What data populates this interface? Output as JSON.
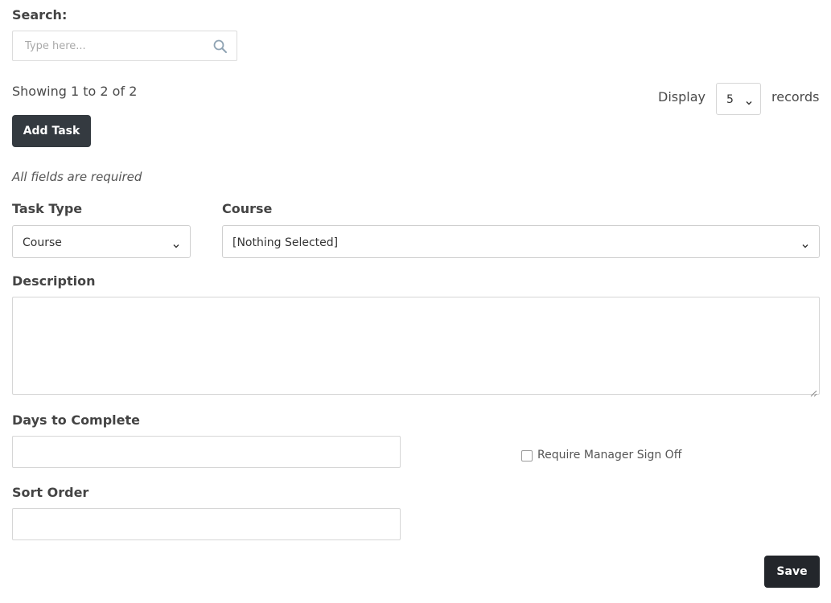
{
  "search": {
    "label": "Search:",
    "placeholder": "Type here...",
    "value": "",
    "icon": "search-icon"
  },
  "listing": {
    "showing_text": "Showing 1 to 2 of 2",
    "display_label": "Display",
    "records_value": "5",
    "records_label": "records"
  },
  "actions": {
    "add_task_label": "Add Task",
    "save_label": "Save"
  },
  "form": {
    "required_note": "All fields are required",
    "task_type": {
      "label": "Task Type",
      "selected": "Course"
    },
    "course": {
      "label": "Course",
      "selected": "[Nothing Selected]"
    },
    "description": {
      "label": "Description",
      "value": ""
    },
    "days_to_complete": {
      "label": "Days to Complete",
      "value": ""
    },
    "require_manager_sign_off": {
      "label": "Require Manager Sign Off",
      "checked": false
    },
    "sort_order": {
      "label": "Sort Order",
      "value": ""
    }
  },
  "colors": {
    "button_dark": "#343a40",
    "text": "#444444",
    "border": "#d6d6d6"
  }
}
